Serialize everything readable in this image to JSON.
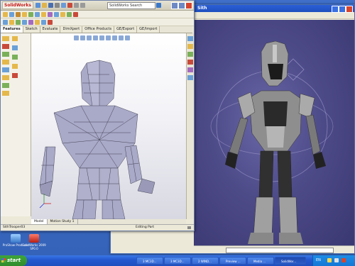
{
  "desktop": {
    "icons": [
      {
        "label": "ProShow Producer",
        "color": "#6da6e8"
      },
      {
        "label": "SolidWorks 2009 SP0.0",
        "color": "#c23a2a"
      }
    ]
  },
  "viewer": {
    "title": "Sith"
  },
  "solidworks": {
    "app_name": "SolidWorks",
    "search_placeholder": "SolidWorks Search",
    "tabs": [
      "Features",
      "Sketch",
      "Evaluate",
      "DimXpert",
      "Office Products",
      "GE/Export",
      "GE/Import"
    ],
    "active_tab": "Features",
    "part_name": "SithTrooper03",
    "bottom_tabs": [
      "Model",
      "Motion Study 1"
    ],
    "status": "Editing Part"
  },
  "taskbar": {
    "start_label": "start",
    "buttons": [
      "3 MC3D...",
      "3 MC3D...",
      "2 WIND...",
      "Preview ...",
      "Media ...",
      "SolidWor..."
    ],
    "tray_lang": "EN",
    "tray_icons": [
      "speaker-icon",
      "network-icon",
      "shield-icon"
    ],
    "colors": {
      "taskbar": "#2459d0",
      "start": "#2f8c2c",
      "viewer_bg": "#4d4a88"
    }
  }
}
